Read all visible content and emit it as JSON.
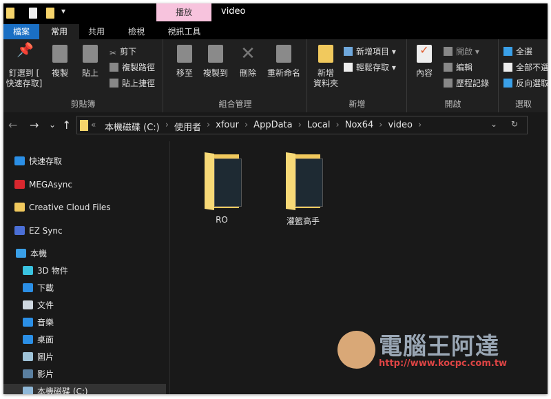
{
  "window": {
    "title": "video",
    "context_tab": "播放"
  },
  "tabs": [
    "檔案",
    "常用",
    "共用",
    "檢視",
    "視訊工具"
  ],
  "ribbon": {
    "clipboard": {
      "label": "剪貼簿",
      "pin": "釘選到 [",
      "pin2": "快速存取]",
      "copy": "複製",
      "paste": "貼上",
      "cut": "剪下",
      "copy_path": "複製路徑",
      "paste_shortcut": "貼上捷徑"
    },
    "organize": {
      "label": "組合管理",
      "move_to": "移至",
      "copy_to": "複製到",
      "delete": "刪除",
      "rename": "重新命名"
    },
    "new": {
      "label": "新增",
      "new_folder": "新增",
      "new_folder2": "資料夾",
      "new_item": "新增項目 ▾",
      "easy_access": "輕鬆存取 ▾"
    },
    "open": {
      "label": "開啟",
      "properties": "內容",
      "open": "開啟 ▾",
      "edit": "編輯",
      "history": "歷程記錄"
    },
    "select": {
      "label": "選取",
      "select_all": "全選",
      "select_none": "全部不選",
      "invert": "反向選取"
    }
  },
  "nav": {
    "back": "←",
    "forward": "→",
    "recent": "⌄",
    "up": "↑",
    "overflow": "«",
    "dropdown": "⌄",
    "refresh": "↻",
    "breadcrumb": [
      "本機磁碟 (C:)",
      "使用者",
      "xfour",
      "AppData",
      "Local",
      "Nox64",
      "video"
    ]
  },
  "sidebar": {
    "items": [
      {
        "label": "快速存取",
        "icon": "star-icon",
        "color": "#2b8fe6"
      },
      {
        "label": "MEGAsync",
        "icon": "mega-icon",
        "color": "#d9272e"
      },
      {
        "label": "Creative Cloud Files",
        "icon": "creative-cloud-folder-icon",
        "color": "#f1c95d"
      },
      {
        "label": "EZ Sync",
        "icon": "ezsync-icon",
        "color": "#4b6fd6"
      },
      {
        "label": "本機",
        "icon": "computer-icon",
        "color": "#3aa0e8"
      },
      {
        "label": "3D 物件",
        "icon": "cube-icon",
        "color": "#3ac3e0"
      },
      {
        "label": "下載",
        "icon": "download-icon",
        "color": "#2b8fe6"
      },
      {
        "label": "文件",
        "icon": "document-icon",
        "color": "#cfd8e0"
      },
      {
        "label": "音樂",
        "icon": "music-icon",
        "color": "#2b8fe6"
      },
      {
        "label": "桌面",
        "icon": "desktop-icon",
        "color": "#2b8fe6"
      },
      {
        "label": "圖片",
        "icon": "pictures-icon",
        "color": "#9fc3d8"
      },
      {
        "label": "影片",
        "icon": "videos-icon",
        "color": "#5a7fa0"
      },
      {
        "label": "本機磁碟 (C:)",
        "icon": "drive-icon",
        "color": "#8fb8d8"
      }
    ]
  },
  "files": [
    {
      "name": "RO"
    },
    {
      "name": "灌籃高手"
    }
  ],
  "watermark": {
    "text": "電腦王阿達",
    "url": "http://www.kocpc.com.tw"
  }
}
